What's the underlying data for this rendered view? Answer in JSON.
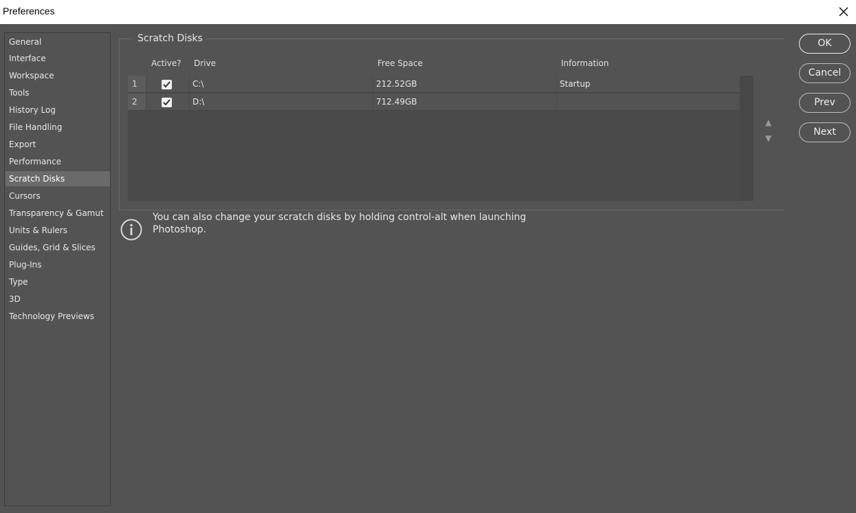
{
  "window": {
    "title": "Preferences"
  },
  "sidebar": {
    "items": [
      {
        "label": "General"
      },
      {
        "label": "Interface"
      },
      {
        "label": "Workspace"
      },
      {
        "label": "Tools"
      },
      {
        "label": "History Log"
      },
      {
        "label": "File Handling"
      },
      {
        "label": "Export"
      },
      {
        "label": "Performance"
      },
      {
        "label": "Scratch Disks",
        "active": true
      },
      {
        "label": "Cursors"
      },
      {
        "label": "Transparency & Gamut"
      },
      {
        "label": "Units & Rulers"
      },
      {
        "label": "Guides, Grid & Slices"
      },
      {
        "label": "Plug-Ins"
      },
      {
        "label": "Type"
      },
      {
        "label": "3D"
      },
      {
        "label": "Technology Previews"
      }
    ]
  },
  "scratch": {
    "group_title": "Scratch Disks",
    "columns": {
      "active": "Active?",
      "drive": "Drive",
      "free": "Free Space",
      "info": "Information"
    },
    "rows": [
      {
        "num": "1",
        "active": true,
        "drive": "C:\\",
        "free": "212.52GB",
        "info": "Startup"
      },
      {
        "num": "2",
        "active": true,
        "drive": "D:\\",
        "free": "712.49GB",
        "info": ""
      }
    ],
    "move_up": "▲",
    "move_down": "▼",
    "note": "You can also change your scratch disks by holding control-alt when launching Photoshop."
  },
  "buttons": {
    "ok": "OK",
    "cancel": "Cancel",
    "prev": "Prev",
    "next": "Next"
  }
}
